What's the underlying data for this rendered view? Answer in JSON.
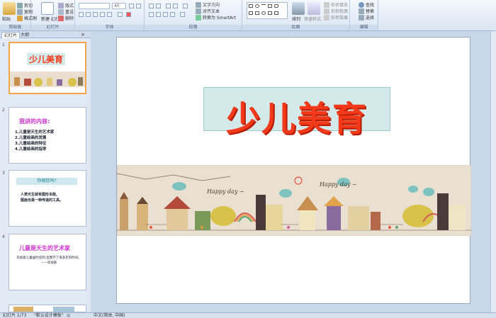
{
  "ribbon": {
    "clipboard": {
      "paste": "粘贴",
      "cut": "剪切",
      "copy": "复制",
      "format_painter": "格式刷",
      "label": "剪贴板"
    },
    "slides": {
      "new_slide": "新建\n幻灯片",
      "layout": "版式",
      "reset": "重设",
      "delete": "删除",
      "label": "幻灯片"
    },
    "font": {
      "font_name": "",
      "font_size": "40",
      "label": "字体"
    },
    "paragraph": {
      "text_direction": "文字方向",
      "align_text": "对齐文本",
      "smartart": "转换为 SmartArt",
      "label": "段落"
    },
    "drawing": {
      "arrange": "排列",
      "quick_styles": "快速样式",
      "shape_fill": "形状填充",
      "shape_outline": "形状轮廓",
      "shape_effects": "形状效果",
      "label": "绘图"
    },
    "editing": {
      "find": "查找",
      "replace": "替换",
      "select": "选择",
      "label": "编辑"
    }
  },
  "panel": {
    "tab_slides": "幻灯片",
    "tab_outline": "大纲"
  },
  "thumbnails": [
    {
      "num": "1",
      "title": "少儿美育"
    },
    {
      "num": "2",
      "title": "我讲的内容:",
      "lines": [
        "1.儿童是天生的艺术家",
        "2.儿童绘画的发展",
        "3.儿童绘画的特征",
        "4.儿童绘画的指导"
      ]
    },
    {
      "num": "3",
      "title": "你相信吗?",
      "lines": [
        "人类天生就有图形本能,",
        "图画也是一种传递的工具。"
      ]
    },
    {
      "num": "4",
      "title": "儿童是天生的艺术家",
      "lines": [
        "毕加索儿童画时说到,但我学了很多年的时间。",
        "——毕加索"
      ]
    }
  ],
  "slide": {
    "title": "少儿美育",
    "banner_text_1": "Happy day ~",
    "banner_text_2": "Happy day ~"
  },
  "status": {
    "slide_info": "幻灯片 1/73",
    "theme": "\"默认设计模板\"",
    "language": "中文(简体, 中国)"
  },
  "colors": {
    "title_red": "#f2391a",
    "accent_orange": "#f2a64a",
    "ribbon_blue": "#dbe6f4"
  }
}
